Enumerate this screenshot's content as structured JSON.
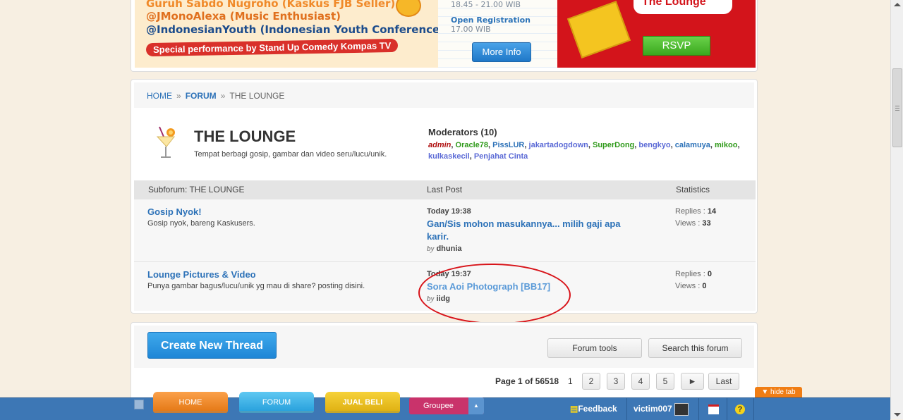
{
  "banner": {
    "line1": "Guruh Sabdo Nugroho (Kaskus FJB Seller)",
    "line2": "@JMonoAlexa (Music Enthusiast)",
    "line3": "@IndonesianYouth (Indonesian Youth Conference)",
    "special": "Special performance by Stand Up Comedy Kompas TV",
    "time1": "18.45 - 21.00 WIB",
    "reg_label": "Open Registration",
    "reg_time": "17.00 WIB",
    "more_info": "More Info",
    "lounge_text": "The Lounge",
    "rsvp": "RSVP"
  },
  "breadcrumb": {
    "home": "HOME",
    "forum": "FORUM",
    "current": "THE LOUNGE",
    "sep": "»"
  },
  "forum": {
    "title": "THE LOUNGE",
    "description": "Tempat berbagi gosip, gambar dan video seru/lucu/unik.",
    "moderators_title": "Moderators (10)",
    "moderators": [
      {
        "name": "admin",
        "color": "#b01010",
        "sep": ", "
      },
      {
        "name": "Oracle78",
        "color": "#2f9a1a",
        "sep": ", "
      },
      {
        "name": "PissLUR",
        "color": "#2d72b8",
        "sep": ", "
      },
      {
        "name": "jakartadogdown",
        "color": "#5b6ad6",
        "sep": ", "
      },
      {
        "name": "SuperDong",
        "color": "#2f9a1a",
        "sep": ", "
      },
      {
        "name": "bengkyo",
        "color": "#5b6ad6",
        "sep": ", "
      },
      {
        "name": "calamuya",
        "color": "#2d72b8",
        "sep": ", "
      },
      {
        "name": "mikoo",
        "color": "#2f9a1a",
        "sep": ","
      },
      {
        "name": "kulkaskecil",
        "color": "#5b6ad6",
        "sep": ", "
      },
      {
        "name": "Penjahat Cinta",
        "color": "#5b6ad6",
        "sep": ""
      }
    ]
  },
  "table": {
    "col_subforum": "Subforum: THE LOUNGE",
    "col_lastpost": "Last Post",
    "col_stats": "Statistics",
    "rows": [
      {
        "name": "Gosip Nyok!",
        "desc": "Gosip nyok, bareng Kaskusers.",
        "time": "Today 19:38",
        "post_title": "Gan/Sis mohon masukannya... milih gaji apa karir.",
        "by_label": "by",
        "by": "dhunia",
        "replies_label": "Replies :",
        "replies": "14",
        "views_label": "Views :",
        "views": "33"
      },
      {
        "name": "Lounge Pictures & Video",
        "desc": "Punya gambar bagus/lucu/unik yg mau di share? posting disini.",
        "time": "Today 19:37",
        "post_title": "Sora Aoi Photograph [BB17]",
        "by_label": "by",
        "by": "iidg",
        "replies_label": "Replies :",
        "replies": "0",
        "views_label": "Views :",
        "views": "0"
      }
    ]
  },
  "actions": {
    "create_thread": "Create New Thread",
    "forum_tools": "Forum tools",
    "search_forum": "Search this forum"
  },
  "pagination": {
    "page_label": "Page 1 of 56518",
    "pages": [
      "1",
      "2",
      "3",
      "4",
      "5"
    ],
    "next": "►",
    "last": "Last"
  },
  "navbar": {
    "tabs": [
      "HOME",
      "FORUM",
      "JUAL BELI"
    ],
    "groupee": "Groupee",
    "feedback": "Feedback",
    "username": "victim007",
    "help": "?",
    "hide_tab": "▼ hide tab"
  }
}
